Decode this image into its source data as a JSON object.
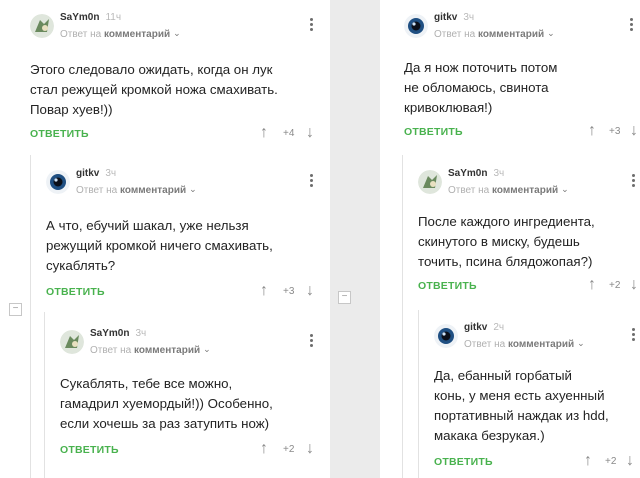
{
  "comments": {
    "c1": {
      "author": "SaYm0n",
      "time": "11ч",
      "reply_prefix": "Ответ на",
      "reply_link": "комментарий",
      "lines": [
        "Этого следовало ожидать, когда он лук",
        "стал режущей кромкой ножа смахивать.",
        "Повар хуев!))"
      ],
      "answer": "ОТВЕТИТЬ",
      "score": "+4"
    },
    "c2": {
      "author": "gitkv",
      "time": "3ч",
      "reply_prefix": "Ответ на",
      "reply_link": "комментарий",
      "lines": [
        "А что, ебучий шакал, уже нельзя",
        "режущий кромкой ничего смахивать,",
        "сукаблять?"
      ],
      "answer": "ОТВЕТИТЬ",
      "score": "+3"
    },
    "c3": {
      "author": "SaYm0n",
      "time": "3ч",
      "reply_prefix": "Ответ на",
      "reply_link": "комментарий",
      "lines": [
        "Сукаблять, тебе все можно,",
        "гамадрил хуемордый!)) Особенно,",
        "если хочешь за раз затупить нож)"
      ],
      "answer": "ОТВЕТИТЬ",
      "score": "+2"
    },
    "c4": {
      "author": "gitkv",
      "time": "3ч",
      "reply_prefix": "Ответ на",
      "reply_link": "комментарий",
      "lines": [
        "Да я нож поточить потом",
        "не обломаюсь, свинота",
        "кривоклювая!)"
      ],
      "answer": "ОТВЕТИТЬ",
      "score": "+3"
    },
    "c5": {
      "author": "SaYm0n",
      "time": "3ч",
      "reply_prefix": "Ответ на",
      "reply_link": "комментарий",
      "lines": [
        "После каждого ингредиента,",
        "скинутого в миску, будешь",
        "точить, псина блядожопая?)"
      ],
      "answer": "ОТВЕТИТЬ",
      "score": "+2"
    },
    "c6": {
      "author": "gitkv",
      "time": "2ч",
      "reply_prefix": "Ответ на",
      "reply_link": "комментарий",
      "lines": [
        "Да, ебанный горбатый",
        "конь, у меня есть ахуенный",
        "портативный наждак из hdd,",
        "макака безрукая.)"
      ],
      "answer": "ОТВЕТИТЬ",
      "score": "+2"
    }
  },
  "icons": {
    "up": "arrow-up-icon",
    "down": "arrow-down-icon",
    "more": "kebab-menu-icon",
    "collapse": "collapse-minus-icon"
  },
  "ui": {
    "collapse_symbol": "−",
    "chevron": "⌄",
    "up_arrow": "↑",
    "down_arrow": "↓"
  },
  "colors": {
    "answer_green": "#49b24e",
    "muted_gray": "#8a8a8a",
    "time_gray": "#b9b9b9"
  }
}
